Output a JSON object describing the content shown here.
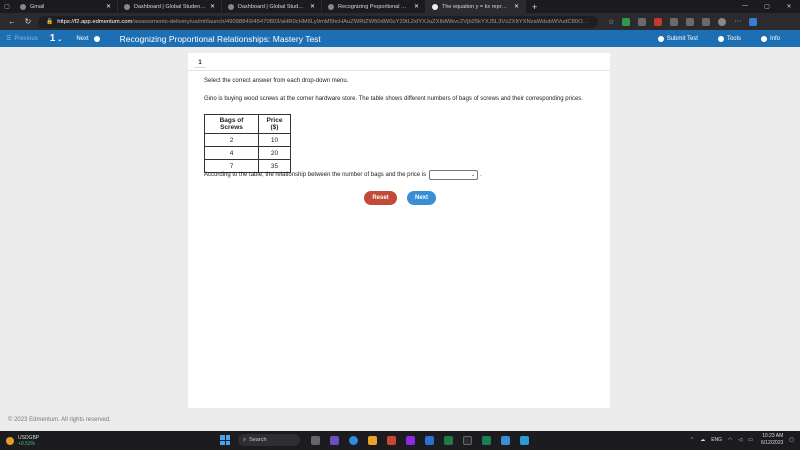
{
  "browser": {
    "tabs": [
      {
        "label": "Gmail",
        "active": false
      },
      {
        "label": "Dashboard | Global Student Netw",
        "active": false
      },
      {
        "label": "Dashboard | Global Student Netw",
        "active": false
      },
      {
        "label": "Recognizing Proportional Relatio",
        "active": false
      },
      {
        "label": "The equation y = kx represents a",
        "active": true
      }
    ],
    "url_host": "https://f2.app.edmentum.com",
    "url_rest": "/assessments-delivery/ua/mt/launch/49098849/45470803/aHR0cHM6Ly9mM5hcHAuZWRtZW50dW0uY29tL2xlYXJuZXItdWkvc2Vjb25kYXJ5L3VzZXItYXNzaWdubWVudC80OTA..."
  },
  "app": {
    "previous_label": "Previous",
    "question_number": "1",
    "next_label": "Next",
    "title": "Recognizing Proportional Relationships: Mastery Test",
    "submit_label": "Submit Test",
    "tools_label": "Tools",
    "info_label": "Info"
  },
  "question": {
    "badge": "1",
    "instruction": "Select the correct answer from each drop-down menu.",
    "prompt": "Gino is buying wood screws at the corner hardware store. The table shows different numbers of bags of screws and their corresponding prices.",
    "table": {
      "headers": [
        "Bags of Screws",
        "Price ($)"
      ],
      "rows": [
        [
          "2",
          "10"
        ],
        [
          "4",
          "20"
        ],
        [
          "7",
          "35"
        ]
      ]
    },
    "sentence": "According to the table, the relationship between the number of bags and the price is",
    "period": ".",
    "dropdown_value": "",
    "reset_label": "Reset",
    "next_label": "Next"
  },
  "footer": {
    "copyright": "© 2023 Edmentum. All rights reserved."
  },
  "taskbar": {
    "ticker_symbol": "USDGBP",
    "ticker_change": "+0.53%",
    "search_label": "Search",
    "lang": "ENG",
    "time": "10:23 AM",
    "date": "6/12/2023"
  },
  "colors": {
    "header_blue": "#1c6fb3",
    "reset_red": "#c24a3a",
    "next_blue": "#3a8ed4"
  }
}
